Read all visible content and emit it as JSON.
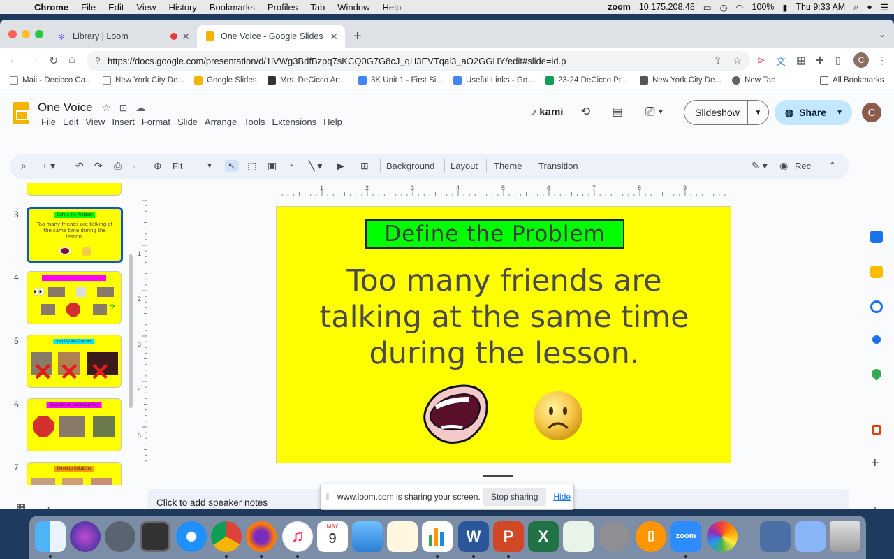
{
  "menubar": {
    "app": "Chrome",
    "items": [
      "File",
      "Edit",
      "View",
      "History",
      "Bookmarks",
      "Profiles",
      "Tab",
      "Window",
      "Help"
    ],
    "zoom_label": "zoom",
    "ip": "10.175.208.48",
    "battery": "100%",
    "clock": "Thu 9:33 AM"
  },
  "browser": {
    "tabs": [
      {
        "title": "Library | Loom"
      },
      {
        "title": "One Voice - Google Slides"
      }
    ],
    "url": "https://docs.google.com/presentation/d/1lVWg3BdfBzpq7sKCQ0G7G8cJ_qH3EVTqal3_aO2GGHY/edit#slide=id.p",
    "profile_initial": "C",
    "bookmarks": [
      "Mail - Decicco Ca...",
      "New York City De...",
      "Google Slides",
      "Mrs. DeCicco Art...",
      "3K Unit 1 - First Si...",
      "Useful Links - Go...",
      "23-24 DeCicco Pr...",
      "New York City De...",
      "New Tab"
    ],
    "all_bookmarks": "All Bookmarks"
  },
  "slides": {
    "doc_title": "One Voice",
    "menu": [
      "File",
      "Edit",
      "View",
      "Insert",
      "Format",
      "Slide",
      "Arrange",
      "Tools",
      "Extensions",
      "Help"
    ],
    "kami": "kami",
    "slideshow_label": "Slideshow",
    "share_label": "Share",
    "account_initial": "C",
    "toolbar": {
      "zoom": "Fit",
      "background": "Background",
      "layout": "Layout",
      "theme": "Theme",
      "transition": "Transition",
      "rec": "Rec"
    },
    "ruler_h": [
      "1",
      "2",
      "3",
      "4",
      "5",
      "6",
      "7",
      "8",
      "9"
    ],
    "ruler_v": [
      "1",
      "2",
      "3",
      "4",
      "5"
    ],
    "thumbnails": [
      {
        "num": "3",
        "title": "Define the Problem",
        "body": "Too many friends are talking at the same time during the lesson."
      },
      {
        "num": "4"
      },
      {
        "num": "5",
        "title": "Identify the Causes"
      },
      {
        "num": "6",
        "title": "Evaluate an existing policy"
      },
      {
        "num": "7",
        "title": "Develop Solutions"
      }
    ],
    "current_slide": {
      "title": "Define the Problem",
      "body": "Too many friends are talking at the same time during the lesson."
    },
    "notes_placeholder": "Click to add speaker notes"
  },
  "loom_banner": {
    "message": "www.loom.com is sharing your screen.",
    "stop": "Stop sharing",
    "hide": "Hide"
  },
  "dock": {
    "calendar_month": "MAY",
    "calendar_day": "9",
    "zoom_label": "zoom"
  }
}
